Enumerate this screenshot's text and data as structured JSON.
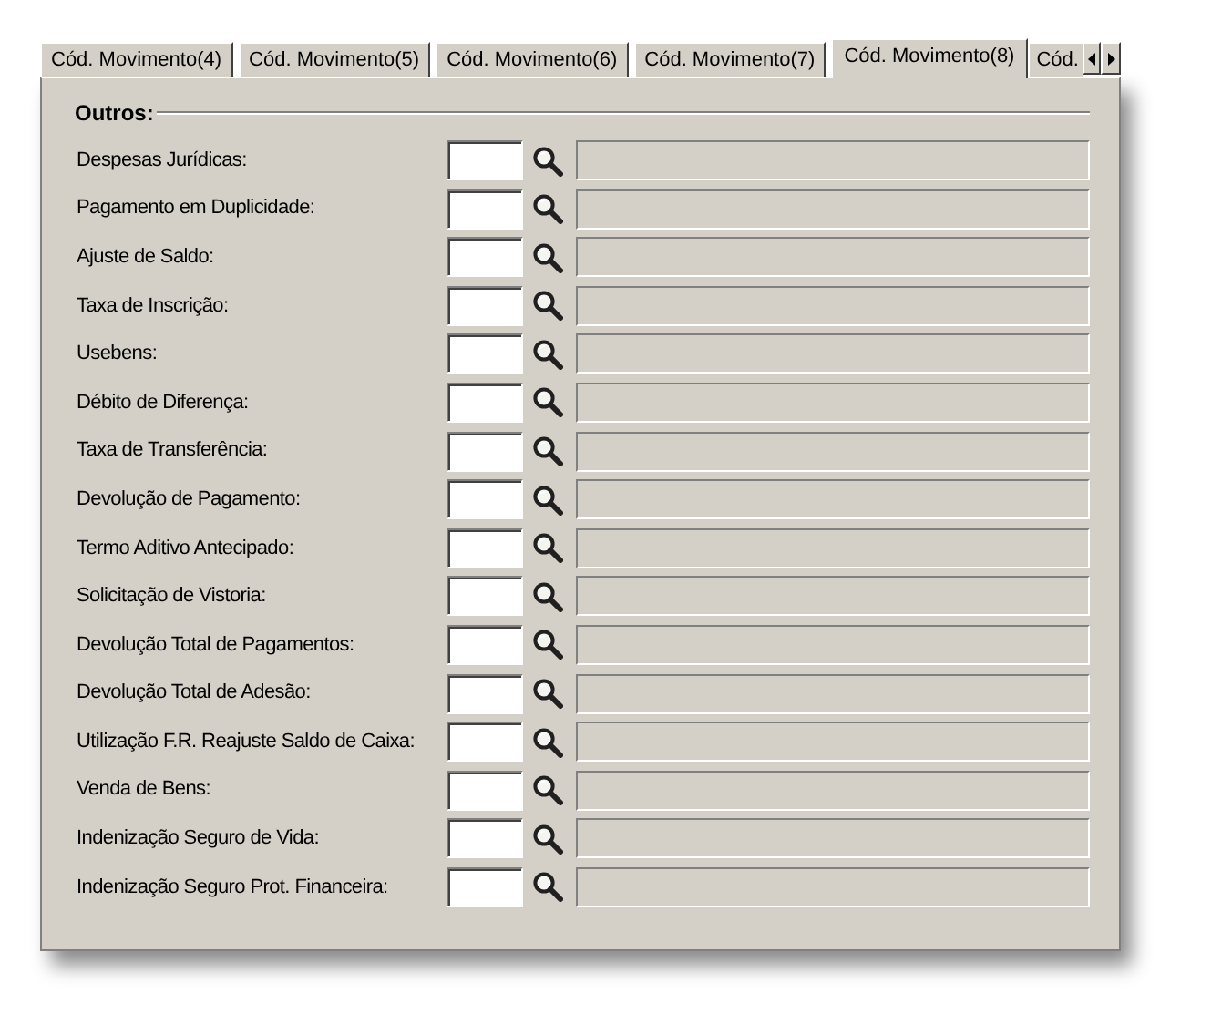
{
  "tabs": [
    {
      "label": "Cód. Movimento(4)",
      "selected": false
    },
    {
      "label": "Cód. Movimento(5)",
      "selected": false
    },
    {
      "label": "Cód. Movimento(6)",
      "selected": false
    },
    {
      "label": "Cód. Movimento(7)",
      "selected": false
    },
    {
      "label": "Cód. Movimento(8)",
      "selected": true
    },
    {
      "label": "Cód.",
      "selected": false
    }
  ],
  "group": {
    "title": "Outros:"
  },
  "rows": [
    {
      "label": "Despesas Jurídicas:",
      "description_disabled": true
    },
    {
      "label": "Pagamento em Duplicidade:",
      "description_disabled": true
    },
    {
      "label": "Ajuste de Saldo:",
      "description_disabled": true
    },
    {
      "label": "Taxa de Inscrição:",
      "description_disabled": true
    },
    {
      "label": "Usebens:",
      "description_disabled": true
    },
    {
      "label": "Débito de Diferença:",
      "description_disabled": true
    },
    {
      "label": "Taxa de Transferência:",
      "description_disabled": true
    },
    {
      "label": "Devolução de Pagamento:",
      "description_disabled": true
    },
    {
      "label": "Termo Aditivo Antecipado:",
      "description_disabled": true
    },
    {
      "label": "Solicitação de Vistoria:",
      "description_disabled": true
    },
    {
      "label": "Devolução Total de Pagamentos:",
      "description_disabled": true
    },
    {
      "label": "Devolução Total de Adesão:",
      "description_disabled": true
    },
    {
      "label": "Utilização F.R. Reajuste Saldo de Caixa:",
      "description_disabled": true
    },
    {
      "label": "Venda de Bens:",
      "description_disabled": true
    },
    {
      "label": "Indenização Seguro de Vida:",
      "description_disabled": true
    },
    {
      "label": "Indenização Seguro Prot. Financeira:",
      "description_disabled": true
    }
  ]
}
